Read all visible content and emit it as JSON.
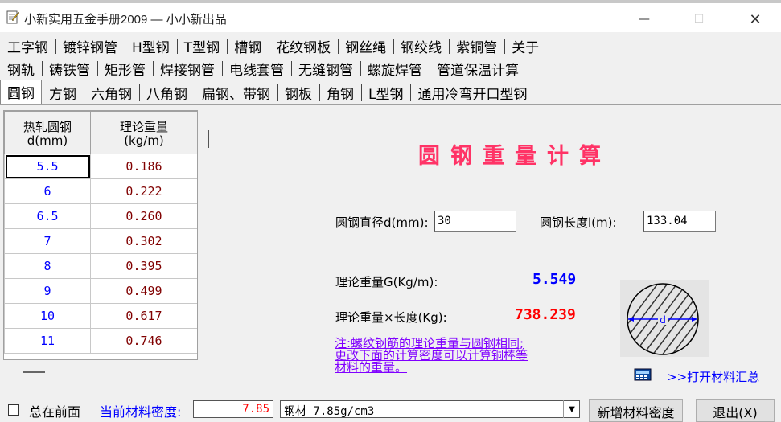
{
  "window": {
    "title": "小新实用五金手册2009 — 小小新出品",
    "minimize": "—",
    "maximize": "☐",
    "close": "✕",
    "icon": "notepad-edit-icon"
  },
  "tabs": {
    "row1": [
      "工字钢",
      "镀锌钢管",
      "H型钢",
      "T型钢",
      "槽钢",
      "花纹钢板",
      "钢丝绳",
      "钢绞线",
      "紫铜管",
      "关于"
    ],
    "row2": [
      "钢轨",
      "铸铁管",
      "矩形管",
      "焊接钢管",
      "电线套管",
      "无缝钢管",
      "螺旋焊管",
      "管道保温计算"
    ],
    "row3": [
      "圆钢",
      "方钢",
      "六角钢",
      "八角钢",
      "扁钢、带钢",
      "钢板",
      "角钢",
      "L型钢",
      "通用冷弯开口型钢"
    ],
    "active": "圆钢"
  },
  "table": {
    "headers": [
      "热轧圆钢\nd(mm)",
      "理论重量\n(kg/m)"
    ],
    "rows": [
      [
        "5.5",
        "0.186"
      ],
      [
        "6",
        "0.222"
      ],
      [
        "6.5",
        "0.260"
      ],
      [
        "7",
        "0.302"
      ],
      [
        "8",
        "0.395"
      ],
      [
        "9",
        "0.499"
      ],
      [
        "10",
        "0.617"
      ],
      [
        "11",
        "0.746"
      ]
    ]
  },
  "calc": {
    "title": "圆钢重量计算",
    "diameter_label": "圆钢直径d(mm):",
    "diameter_value": "30",
    "length_label": "圆钢长度l(m):",
    "length_value": "133.04",
    "weight_per_m_label": "理论重量G(Kg/m):",
    "weight_per_m_value": "5.549",
    "total_label": "理论重量×长度(Kg):",
    "total_value": "738.239",
    "note": "注:螺纹钢筋的理论重量与圆钢相同;\n更改下面的计算密度可以计算铜棒等\n材料的重量。",
    "diagram_label": "d",
    "open_link": ">>打开材料汇总",
    "open_icon": "calculator-icon"
  },
  "bottom": {
    "always_on_top": "总在前面",
    "always_on_top_checked": false,
    "density_label": "当前材料密度:",
    "density_value": "7.85",
    "material_selected": "钢材 7.85g/cm3",
    "add_density": "新增材料密度",
    "exit": "退出(X)"
  }
}
